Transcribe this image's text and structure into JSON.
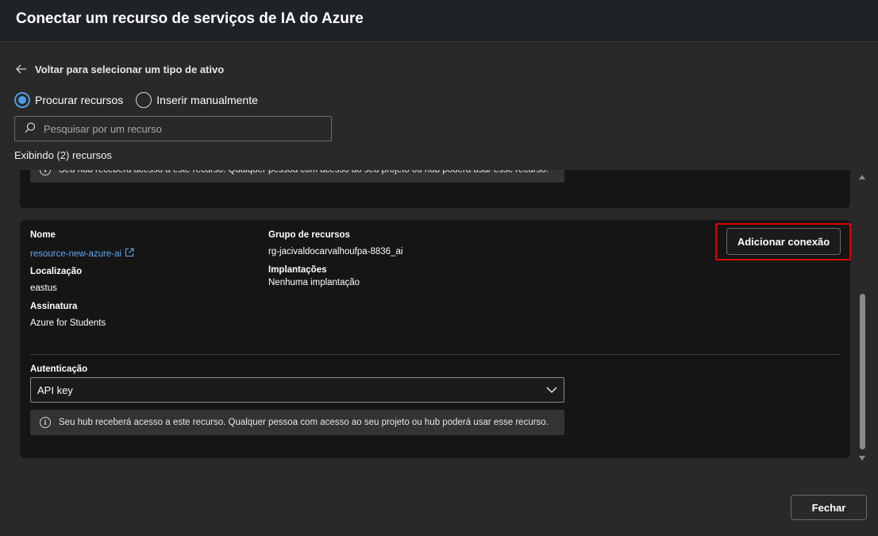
{
  "header": {
    "title": "Conectar um recurso de serviços de IA do Azure"
  },
  "back_link": {
    "label": "Voltar para selecionar um tipo de ativo"
  },
  "radio_options": [
    {
      "label": "Procurar recursos",
      "checked": true
    },
    {
      "label": "Inserir manualmente",
      "checked": false
    }
  ],
  "search": {
    "placeholder": "Pesquisar por um recurso",
    "value": ""
  },
  "showing_text": "Exibindo (2) recursos",
  "info_message": "Seu hub receberá acesso a este recurso. Qualquer pessoa com acesso ao seu projeto ou hub poderá usar esse recurso.",
  "resource": {
    "name_label": "Nome",
    "name_value": "resource-new-azure-ai",
    "location_label": "Localização",
    "location_value": "eastus",
    "subscription_label": "Assinatura",
    "subscription_value": "Azure for Students",
    "resource_group_label": "Grupo de recursos",
    "resource_group_value": "rg-jacivaldocarvalhoufpa-8836_ai",
    "deployments_label": "Implantações",
    "deployments_value": "Nenhuma implantação",
    "add_button_label": "Adicionar conexão",
    "auth_label": "Autenticação",
    "auth_value": "API key"
  },
  "footer": {
    "close_label": "Fechar"
  },
  "colors": {
    "accent": "#4f9ae4",
    "link": "#5fa8f5",
    "highlight": "#e00000",
    "background": "#292929",
    "card": "#151515"
  },
  "icons": [
    "arrow-left-icon",
    "search-icon",
    "info-icon",
    "external-link-icon",
    "chevron-down-icon"
  ]
}
